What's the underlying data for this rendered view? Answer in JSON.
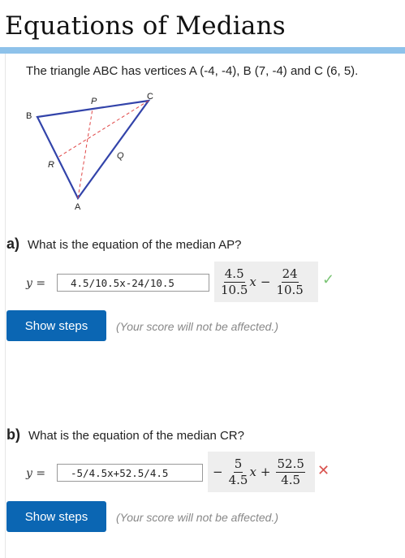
{
  "page": {
    "title": "Equations of Medians",
    "prompt": "The triangle ABC has vertices A (-4, -4), B (7, -4) and C (6, 5)."
  },
  "figure": {
    "vertex_a": "A",
    "vertex_b": "B",
    "vertex_c": "C",
    "mid_p": "P",
    "mid_q": "Q",
    "mid_r": "R"
  },
  "question_a": {
    "letter": "a)",
    "text": "What is the equation of the median AP?",
    "y_label": "y =",
    "answer": "4.5/10.5x-24/10.5",
    "preview": {
      "n1": "4.5",
      "d1": "10.5",
      "var": "x",
      "op": "−",
      "n2": "24",
      "d2": "10.5"
    },
    "status_mark": "✓",
    "status_color": "#7cc576",
    "button": "Show steps",
    "note": "(Your score will not be affected.)"
  },
  "question_b": {
    "letter": "b)",
    "text": "What is the equation of the median CR?",
    "y_label": "y =",
    "answer": "-5/4.5x+52.5/4.5",
    "preview": {
      "sign": "−",
      "n1": "5",
      "d1": "4.5",
      "var": "x",
      "op": "+",
      "n2": "52.5",
      "d2": "4.5"
    },
    "status_mark": "✕",
    "status_color": "#d9534f",
    "button": "Show steps",
    "note": "(Your score will not be affected.)"
  },
  "colors": {
    "accent": "#8ec2ea",
    "button": "#0b66b3",
    "triangle": "#3344aa",
    "median": "#e04848"
  }
}
